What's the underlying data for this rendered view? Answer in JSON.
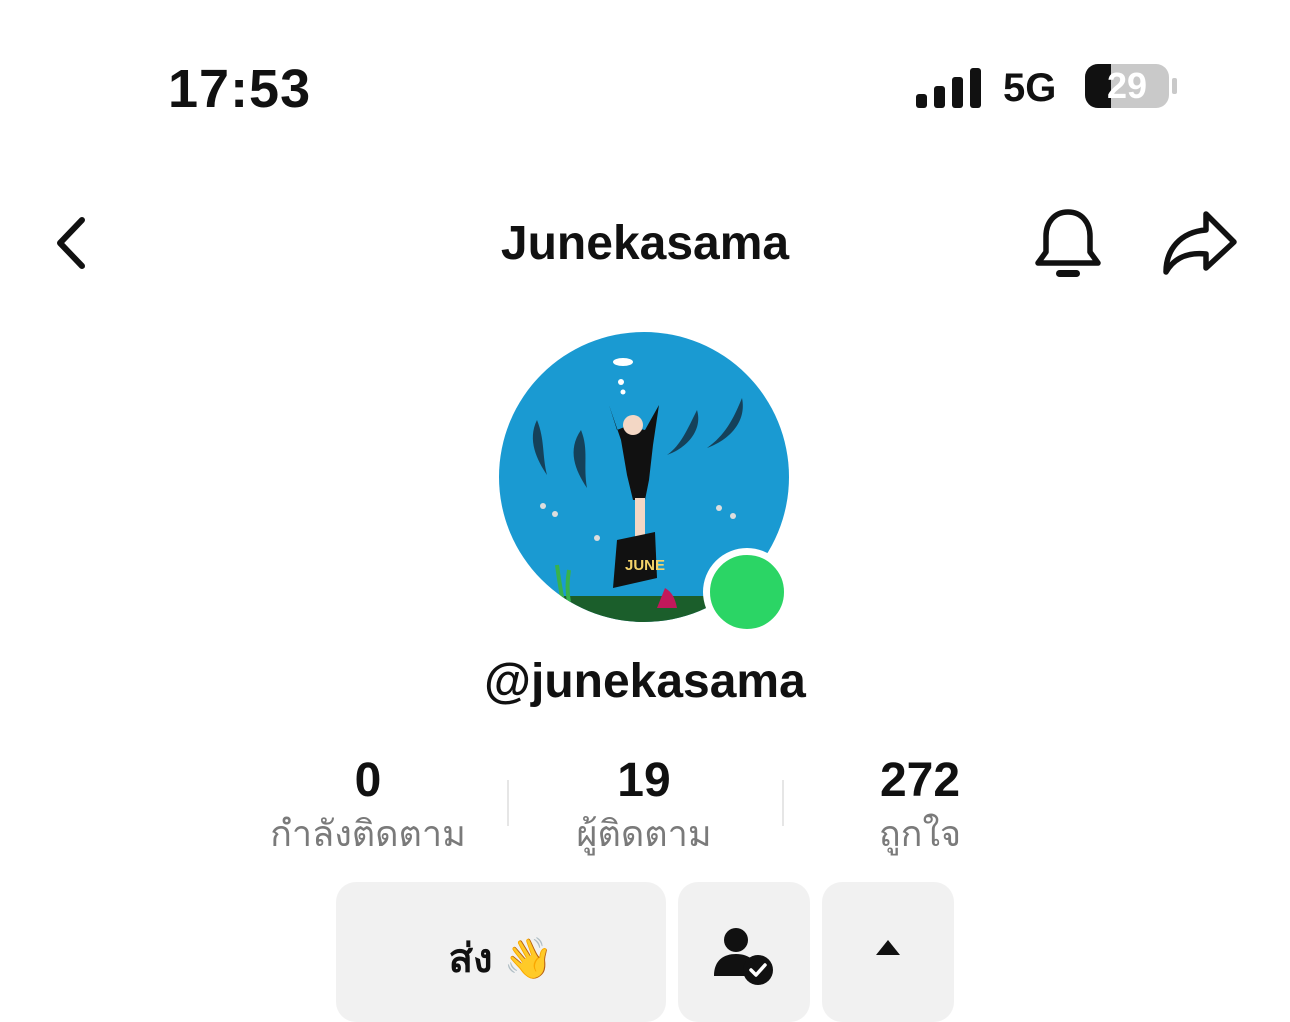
{
  "status_bar": {
    "time": "17:53",
    "network": "5G",
    "battery": "29"
  },
  "header": {
    "title": "Junekasama"
  },
  "profile": {
    "handle": "@junekasama"
  },
  "stats": [
    {
      "value": "0",
      "label": "กำลังติดตาม"
    },
    {
      "value": "19",
      "label": "ผู้ติดตาม"
    },
    {
      "value": "272",
      "label": "ถูกใจ"
    }
  ],
  "actions": {
    "send_label": "ส่ง 👋"
  },
  "colors": {
    "online": "#2bd565",
    "button_bg": "#f1f1f1",
    "avatar_sea": "#1a9ad2"
  }
}
